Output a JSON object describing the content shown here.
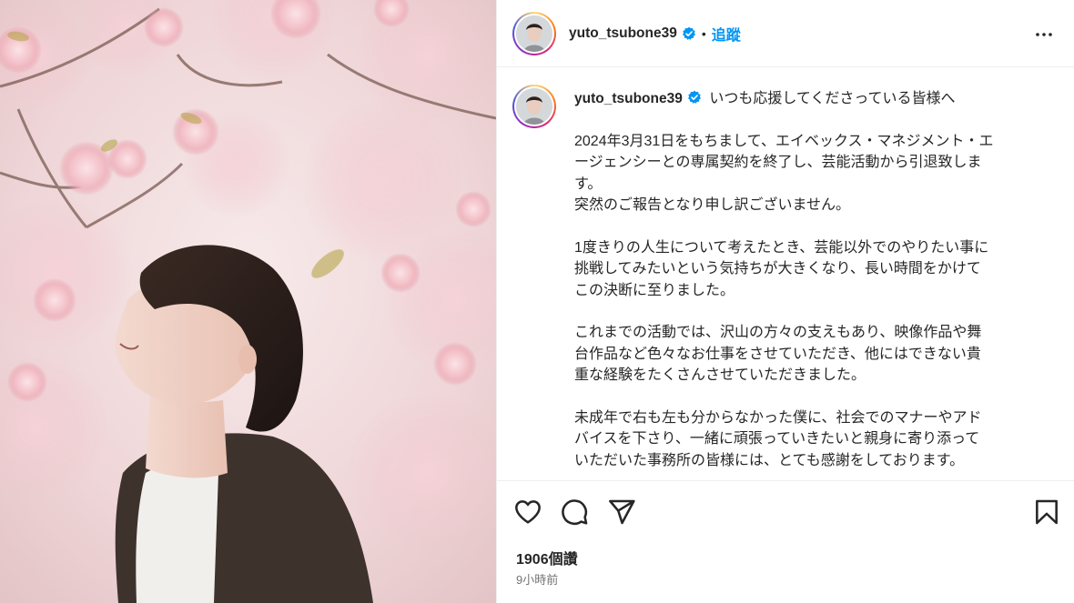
{
  "post": {
    "username": "yuto_tsubone39",
    "follow_label": "追蹤",
    "separator": "•"
  },
  "caption": {
    "first_line": "いつも応援してくださっている皆様へ",
    "paragraphs": [
      [
        "2024年3月31日をもちまして、エイベックス・マネジメント・エ",
        "ージェンシーとの専属契約を終了し、芸能活動から引退致しま",
        "す。",
        "突然のご報告となり申し訳ございません。"
      ],
      [
        "1度きりの人生について考えたとき、芸能以外でのやりたい事に",
        "挑戦してみたいという気持ちが大きくなり、長い時間をかけて",
        "この決断に至りました。"
      ],
      [
        "これまでの活動では、沢山の方々の支えもあり、映像作品や舞",
        "台作品など色々なお仕事をさせていただき、他にはできない貴",
        "重な経験をたくさんさせていただきました。"
      ],
      [
        "未成年で右も左も分からなかった僕に、社会でのマナーやアド",
        "バイスを下さり、一緒に頑張っていきたいと親身に寄り添って",
        "いただいた事務所の皆様には、とても感謝をしております。"
      ]
    ]
  },
  "stats": {
    "likes": "1906個讚",
    "time_ago": "9小時前"
  },
  "icons": {
    "like": "heart-icon",
    "comment": "comment-icon",
    "share": "send-icon",
    "save": "bookmark-icon",
    "more": "more-options-icon",
    "verified": "verified-badge-icon"
  },
  "colors": {
    "link_blue": "#0095f6",
    "verified_blue": "#0095f6",
    "muted_text": "#737373"
  }
}
